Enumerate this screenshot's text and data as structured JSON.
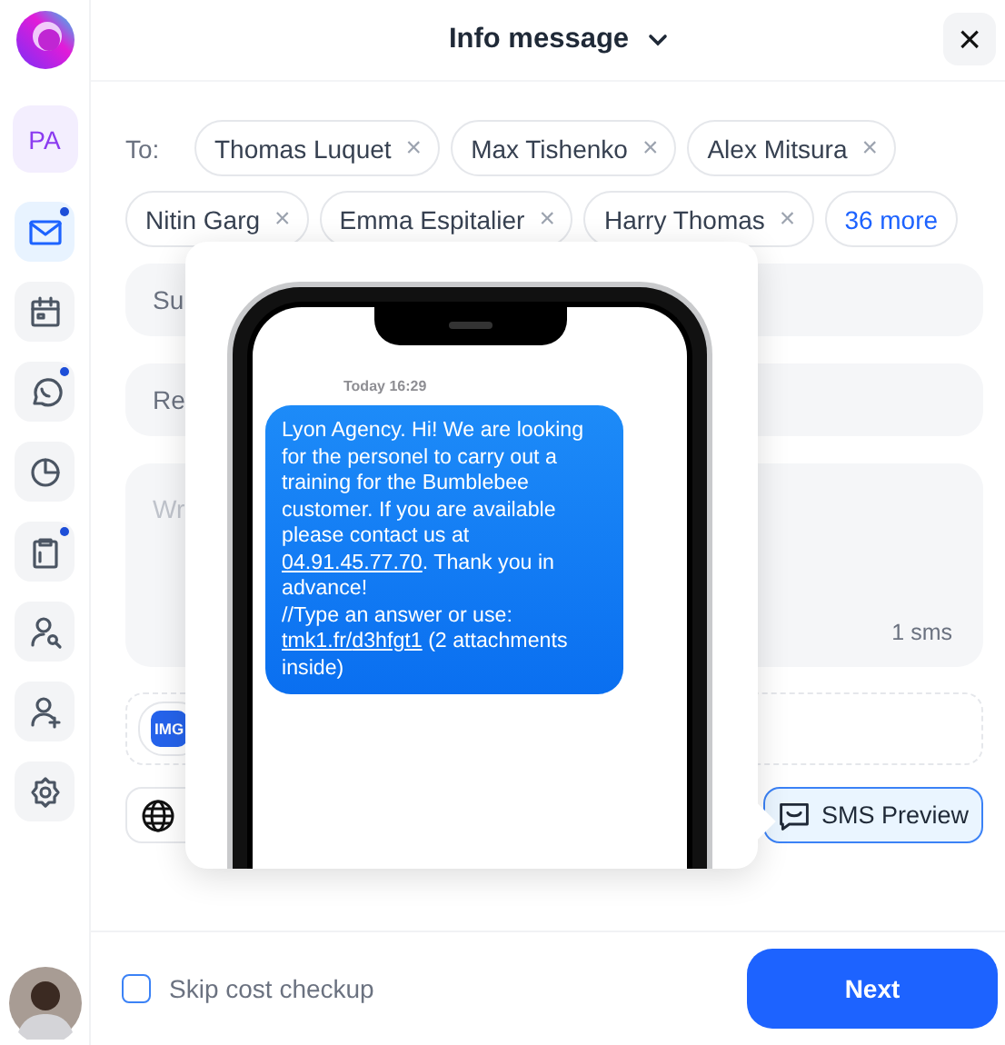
{
  "sidebar": {
    "profile": "PA",
    "items": [
      {
        "selected": true,
        "notification": true
      },
      {
        "selected": false,
        "notification": false
      },
      {
        "selected": false,
        "notification": true
      },
      {
        "selected": false,
        "notification": false
      },
      {
        "selected": false,
        "notification": true
      },
      {
        "selected": false,
        "notification": false
      },
      {
        "selected": false,
        "notification": false
      },
      {
        "selected": false,
        "notification": false
      }
    ]
  },
  "header": {
    "title": "Info message",
    "close": "×"
  },
  "recipients": {
    "label": "To:",
    "remove": "×",
    "chips": [
      {
        "name": "Thomas Luquet"
      },
      {
        "name": "Max Tishenko"
      },
      {
        "name": "Alex Mitsura"
      },
      {
        "name": "Nitin Garg"
      },
      {
        "name": "Emma Espitalier"
      },
      {
        "name": "Harry Thomas"
      }
    ],
    "more": "36 more"
  },
  "subject": {
    "placeholder": "Su"
  },
  "reply_to": {
    "placeholder": "Re"
  },
  "body": {
    "placeholder": "Wr",
    "count": "1 sms"
  },
  "attachment": {
    "badge": "IMG"
  },
  "sms_preview": {
    "label": "SMS Preview",
    "selected": true
  },
  "preview": {
    "time": "Today 16:29",
    "paragraphs": [
      [
        {
          "text": "Lyon Agency. Hi! We are looking for the personel to carry out a training for the Bumblebee customer. If you are available please contact us at ",
          "link": false
        },
        {
          "text": "04.91.45.77.70",
          "link": true
        },
        {
          "text": ". Thank you in advance!",
          "link": false
        }
      ],
      [
        {
          "text": "//Type an answer or use: ",
          "link": false
        },
        {
          "text": "tmk1.fr/",
          "link": true
        },
        {
          "text": "d3hfgt1",
          "link": true
        },
        {
          "text": " (2 attachments inside)",
          "link": false
        }
      ]
    ]
  },
  "footer": {
    "skip_label": "Skip cost checkup",
    "checked": false,
    "next": "Next"
  }
}
